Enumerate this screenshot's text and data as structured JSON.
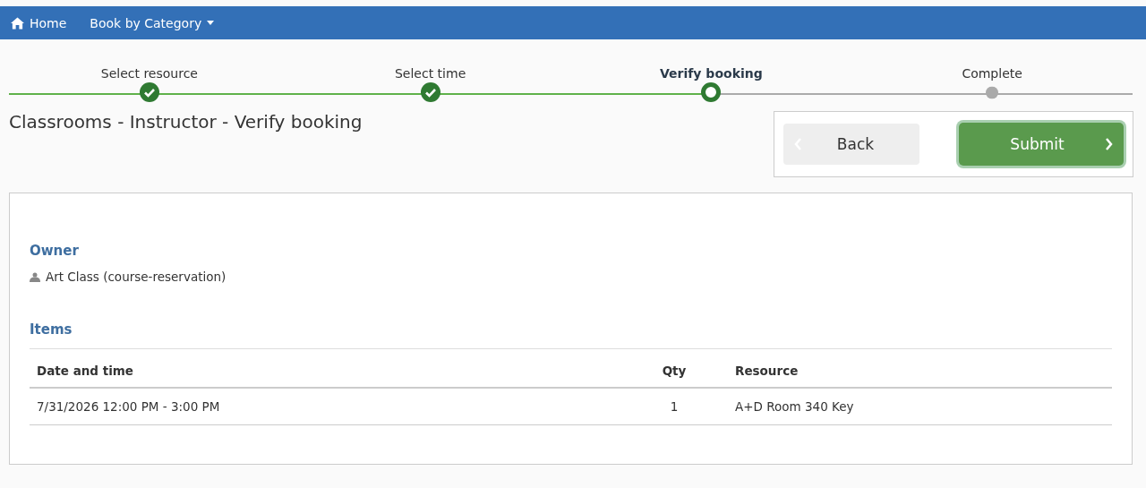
{
  "navbar": {
    "items": [
      {
        "label": "Home",
        "kind": "home"
      },
      {
        "label": "Book by Category",
        "kind": "dropdown"
      }
    ]
  },
  "steps": [
    {
      "label": "Select resource",
      "completed": true,
      "selected": false
    },
    {
      "label": "Select time",
      "completed": true,
      "selected": false
    },
    {
      "label": "Verify booking",
      "completed": false,
      "selected": true
    },
    {
      "label": "Complete",
      "completed": false,
      "selected": false
    }
  ],
  "page_title": "Classrooms - Instructor - Verify booking",
  "actions": {
    "back": "Back",
    "submit": "Submit"
  },
  "owner": {
    "heading": "Owner",
    "name": "Art Class (course-reservation)"
  },
  "items": {
    "heading": "Items",
    "columns": [
      "Date and time",
      "Qty",
      "Resource"
    ],
    "rows": [
      [
        "7/31/2026 12:00 PM - 3:00 PM",
        "1",
        "A+D Room 340 Key"
      ]
    ]
  }
}
